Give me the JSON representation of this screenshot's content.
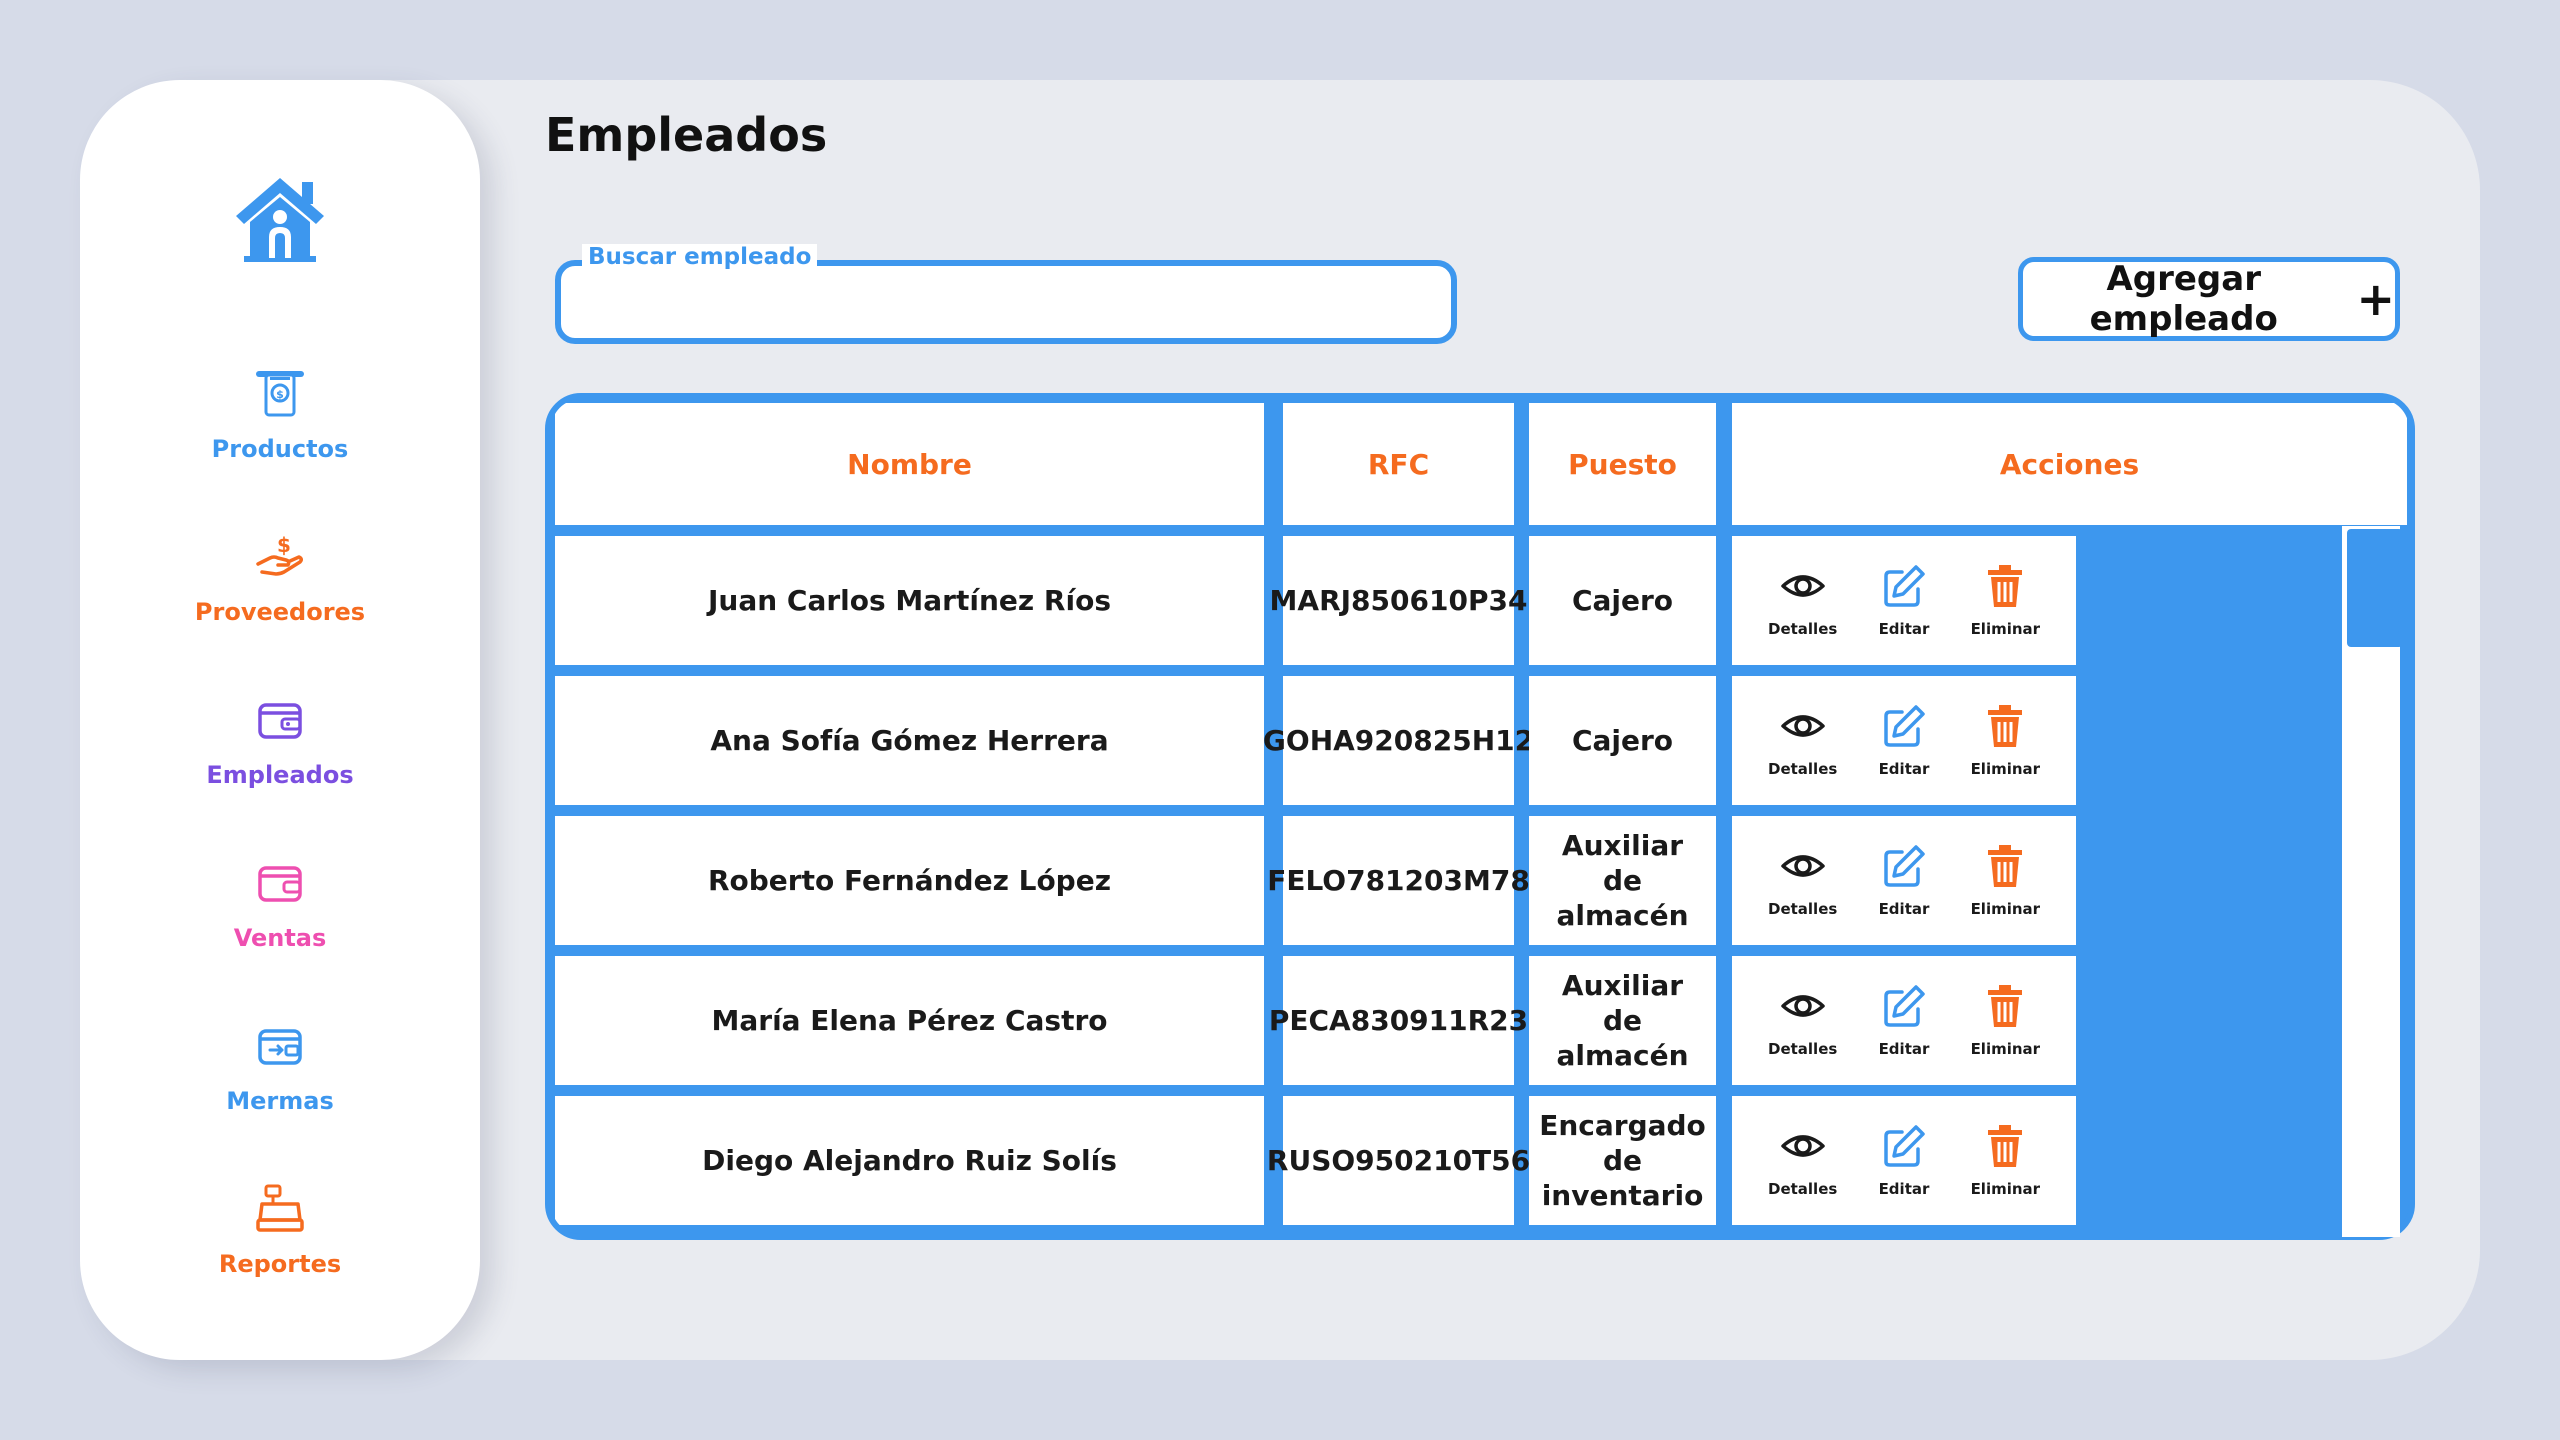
{
  "page_title": "Empleados",
  "sidebar": {
    "items": [
      {
        "label": "Productos",
        "color": "#3d97ee",
        "icon": "atm-money-icon"
      },
      {
        "label": "Proveedores",
        "color": "#f56b1f",
        "icon": "hand-dollar-icon"
      },
      {
        "label": "Empleados",
        "color": "#7b4fe0",
        "icon": "wallet-icon"
      },
      {
        "label": "Ventas",
        "color": "#ee4fb0",
        "icon": "wallet-icon"
      },
      {
        "label": "Mermas",
        "color": "#3d97ee",
        "icon": "wallet-transfer-icon"
      },
      {
        "label": "Reportes",
        "color": "#f56b1f",
        "icon": "cash-register-icon"
      }
    ]
  },
  "search": {
    "label": "Buscar empleado",
    "value": "",
    "placeholder": ""
  },
  "add_button": {
    "label": "Agregar empleado",
    "icon": "+"
  },
  "table": {
    "headers": [
      "Nombre",
      "RFC",
      "Puesto",
      "Acciones"
    ],
    "rows": [
      {
        "nombre": "Juan Carlos Martínez Ríos",
        "rfc": "MARJ850610P34",
        "puesto": "Cajero"
      },
      {
        "nombre": "Ana Sofía Gómez Herrera",
        "rfc": "GOHA920825H12",
        "puesto": "Cajero"
      },
      {
        "nombre": "Roberto Fernández López",
        "rfc": "FELO781203M78",
        "puesto": "Auxiliar de almacén"
      },
      {
        "nombre": "María Elena Pérez Castro",
        "rfc": "PECA830911R23",
        "puesto": "Auxiliar de almacén"
      },
      {
        "nombre": "Diego Alejandro Ruiz Solís",
        "rfc": "RUSO950210T56",
        "puesto": "Encargado de inventario"
      }
    ],
    "actions": {
      "details": "Detalles",
      "edit": "Editar",
      "delete": "Eliminar"
    }
  },
  "colors": {
    "accent": "#3d97ee",
    "header_text": "#f56b1f",
    "delete": "#f56b1f",
    "background": "#d6dbe8",
    "panel": "#e9ebf0"
  }
}
